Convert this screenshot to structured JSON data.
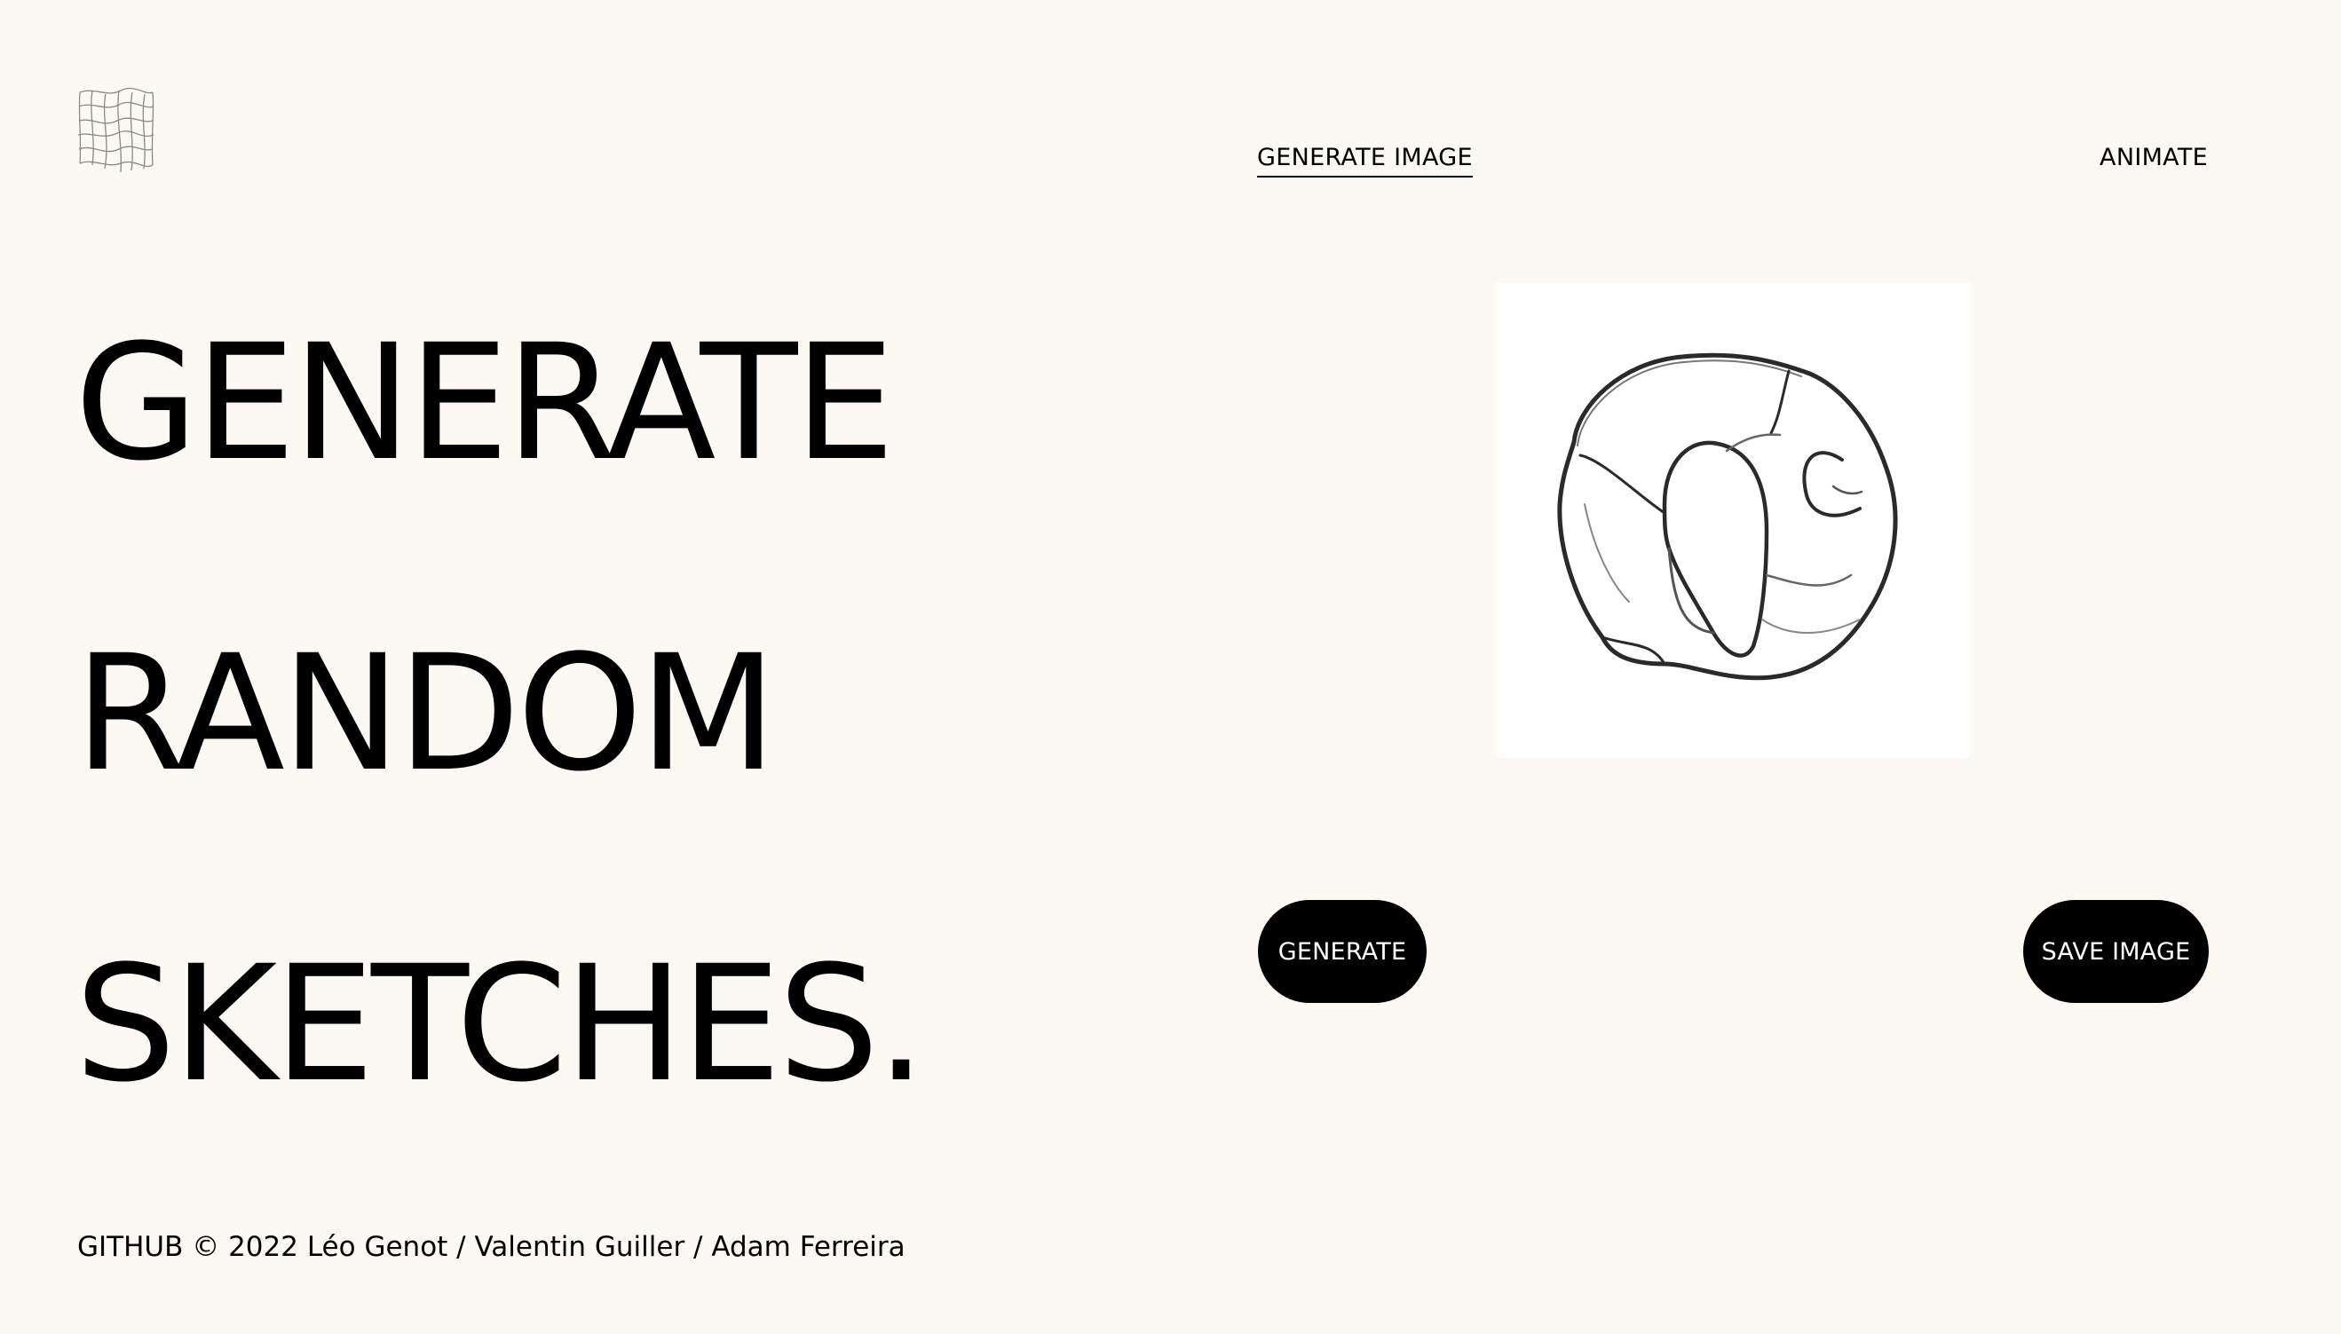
{
  "logo": {
    "icon": "warped-grid-icon"
  },
  "nav": {
    "generate_image": "GENERATE IMAGE",
    "animate": "ANIMATE"
  },
  "hero": {
    "line1": "GENERATE",
    "line2": "RANDOM",
    "line3": "SKETCHES."
  },
  "canvas": {
    "subject": "sketch-drawing"
  },
  "buttons": {
    "generate": "GENERATE",
    "save_image": "SAVE IMAGE"
  },
  "footer": {
    "github": "GITHUB",
    "credits": " © 2022 Léo Genot / Valentin Guiller / Adam Ferreira"
  },
  "colors": {
    "background": "#fcf9f4",
    "text": "#000000",
    "button_bg": "#000000",
    "button_text": "#ffffff",
    "canvas_bg": "#ffffff"
  }
}
